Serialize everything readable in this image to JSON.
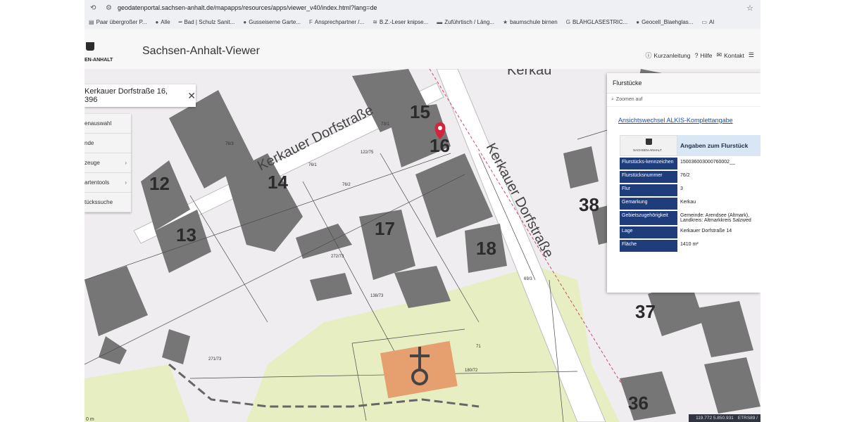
{
  "browser": {
    "url": "geodatenportal.sachsen-anhalt.de/mapapps/resources/apps/viewer_v40/index.html?lang=de",
    "bookmarks": [
      {
        "icon": "bookmark-icon",
        "label": "Paar übergroßer P..."
      },
      {
        "icon": "globe-icon",
        "label": "Alle"
      },
      {
        "icon": "globe-icon",
        "label": "Bad | Schulz Sanit..."
      },
      {
        "icon": "globe-icon",
        "label": "Gusseiserne Garte..."
      },
      {
        "icon": "flag-icon",
        "label": "Ansprechpartner /..."
      },
      {
        "icon": "globe-icon",
        "label": "B.Z.-Leser knipse..."
      },
      {
        "icon": "globe-icon",
        "label": "Zuführtisch / Läng..."
      },
      {
        "icon": "star-icon",
        "label": "baumschule birnen"
      },
      {
        "icon": "google-icon",
        "label": "BLÄHGLASESTRIC..."
      },
      {
        "icon": "globe-icon",
        "label": "Geocell_Blaehglas..."
      },
      {
        "icon": "folder-icon",
        "label": "Al"
      }
    ]
  },
  "header": {
    "logo_text": "EN-ANHALT",
    "title": "Sachsen-Anhalt-Viewer",
    "links": [
      {
        "icon": "info-icon",
        "label": "Kurzanleitung"
      },
      {
        "icon": "help-icon",
        "label": "Hilfe"
      },
      {
        "icon": "mail-icon",
        "label": "Kontakt"
      },
      {
        "icon": "list-icon",
        "label": ""
      }
    ]
  },
  "search": {
    "value": "Kerkauer Dorfstraße 16, 396"
  },
  "toolmenu": [
    {
      "label": "enauswahl",
      "chevron": false
    },
    {
      "label": "nde",
      "chevron": false
    },
    {
      "label": "zeuge",
      "chevron": true
    },
    {
      "label": "artentools",
      "chevron": true
    },
    {
      "label": "tückssuche",
      "chevron": false
    }
  ],
  "panel": {
    "title": "Flurstücke",
    "zoom_label": "Zoomen auf",
    "link": "Ansichtswechsel ALKIS-Komplettangabe",
    "table_logo_text": "SACHSEN-ANHALT",
    "table_title": "Angaben zum Flurstück",
    "rows": [
      {
        "key": "Flurstücks-kennzeichen",
        "value": "150036003000760002__"
      },
      {
        "key": "Flurstücksnummer",
        "value": "76/2"
      },
      {
        "key": "Flur",
        "value": "3"
      },
      {
        "key": "Gemarkung",
        "value": "Kerkau"
      },
      {
        "key": "Gebietszugehörigkeit",
        "value": "Gemeinde: Arendsee (Altmark), Landkreis: Altmarkkreis Salzwed"
      },
      {
        "key": "Lage",
        "value": "Kerkauer Dorfstraße 14"
      },
      {
        "key": "Fläche",
        "value": "1410 m²"
      }
    ]
  },
  "map": {
    "street_labels": [
      "Kerkauer Dorfstraße",
      "Kerkauer Dorfstraße",
      "Kerkau"
    ],
    "house_numbers": [
      "15",
      "16",
      "12",
      "14",
      "13",
      "17",
      "18",
      "38",
      "37",
      "36"
    ],
    "parcel_labels": [
      "76/3",
      "76/1",
      "73/1",
      "122/75",
      "76/2",
      "272/73",
      "138/73",
      "69/3",
      "71",
      "271/73",
      "180/72"
    ],
    "scale_text": "0 m",
    "coords": [
      "119.772 5.850.931",
      "ETRS89 /"
    ]
  }
}
